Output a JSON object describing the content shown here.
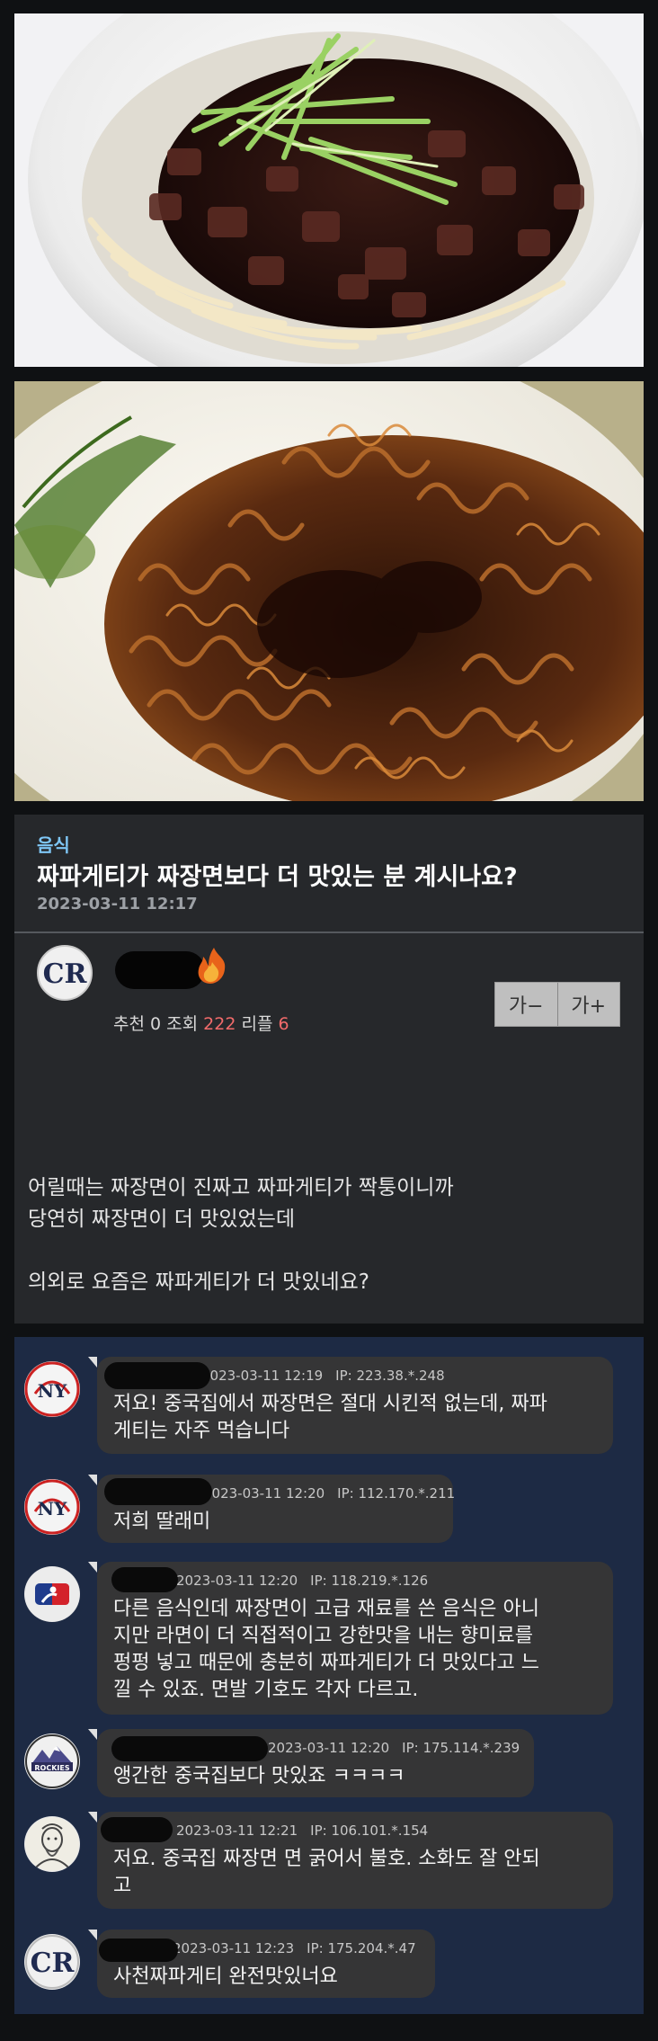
{
  "images": [
    {
      "name": "jjajangmyeon-photo"
    },
    {
      "name": "jjapaghetti-photo"
    }
  ],
  "post": {
    "category": "음식",
    "title": "짜파게티가 짜장면보다 더 맛있는 분 계시나요?",
    "date": "2023-03-11 12:17",
    "author_team_icon": "rockies-cr-logo",
    "level_icon": "flame-icon",
    "stats": {
      "recommend_label": "추천",
      "recommend": "0",
      "views_label": "조회",
      "views": "222",
      "replies_label": "리플",
      "replies": "6"
    },
    "font_buttons": {
      "decrease": "가−",
      "increase": "가+"
    },
    "body": {
      "line1": "어릴때는 짜장면이 진짜고 짜파게티가 짝퉁이니까",
      "line2": "당연히 짜장면이 더 맛있었는데",
      "line3": "의외로 요즘은 짜파게티가 더 맛있네요?"
    }
  },
  "comments": [
    {
      "avatar": "yankees-logo",
      "date": "2023-03-11 12:19",
      "ip": "IP: 223.38.*.248",
      "lines": [
        "저요! 중국집에서 짜장면은 절대 시킨적 없는데, 짜파",
        "게티는 자주 먹습니다"
      ]
    },
    {
      "avatar": "yankees-logo",
      "date": "2023-03-11 12:20",
      "ip": "IP: 112.170.*.211",
      "lines": [
        "저희 딸래미"
      ]
    },
    {
      "avatar": "mlb-logo",
      "date": "2023-03-11 12:20",
      "ip": "IP: 118.219.*.126",
      "lines": [
        "다른 음식인데 짜장면이 고급 재료를 쓴 음식은 아니",
        "지만 라면이 더 직접적이고 강한맛을 내는 향미료를",
        "펑펑 넣고 때문에 충분히 짜파게티가 더 맛있다고 느",
        "낄 수 있죠. 면발 기호도 각자 다르고."
      ]
    },
    {
      "avatar": "rockies-logo",
      "date": "2023-03-11 12:20",
      "ip": "IP: 175.114.*.239",
      "lines": [
        "앵간한 중국집보다 맛있죠 ㅋㅋㅋㅋ"
      ]
    },
    {
      "avatar": "portrait-avatar",
      "date": "2023-03-11 12:21",
      "ip": "IP: 106.101.*.154",
      "lines": [
        "저요. 중국집 짜장면 면 굵어서 불호. 소화도 잘 안되",
        "고"
      ]
    },
    {
      "avatar": "rockies-cr-logo",
      "date": "2023-03-11 12:23",
      "ip": "IP: 175.204.*.47",
      "lines": [
        "사천짜파게티 완전맛있너요"
      ]
    }
  ],
  "colors": {
    "accent": "#7ec6f5",
    "count_red": "#f26b6b",
    "comment_bg": "#1d2a44",
    "post_bg": "#26282b"
  }
}
